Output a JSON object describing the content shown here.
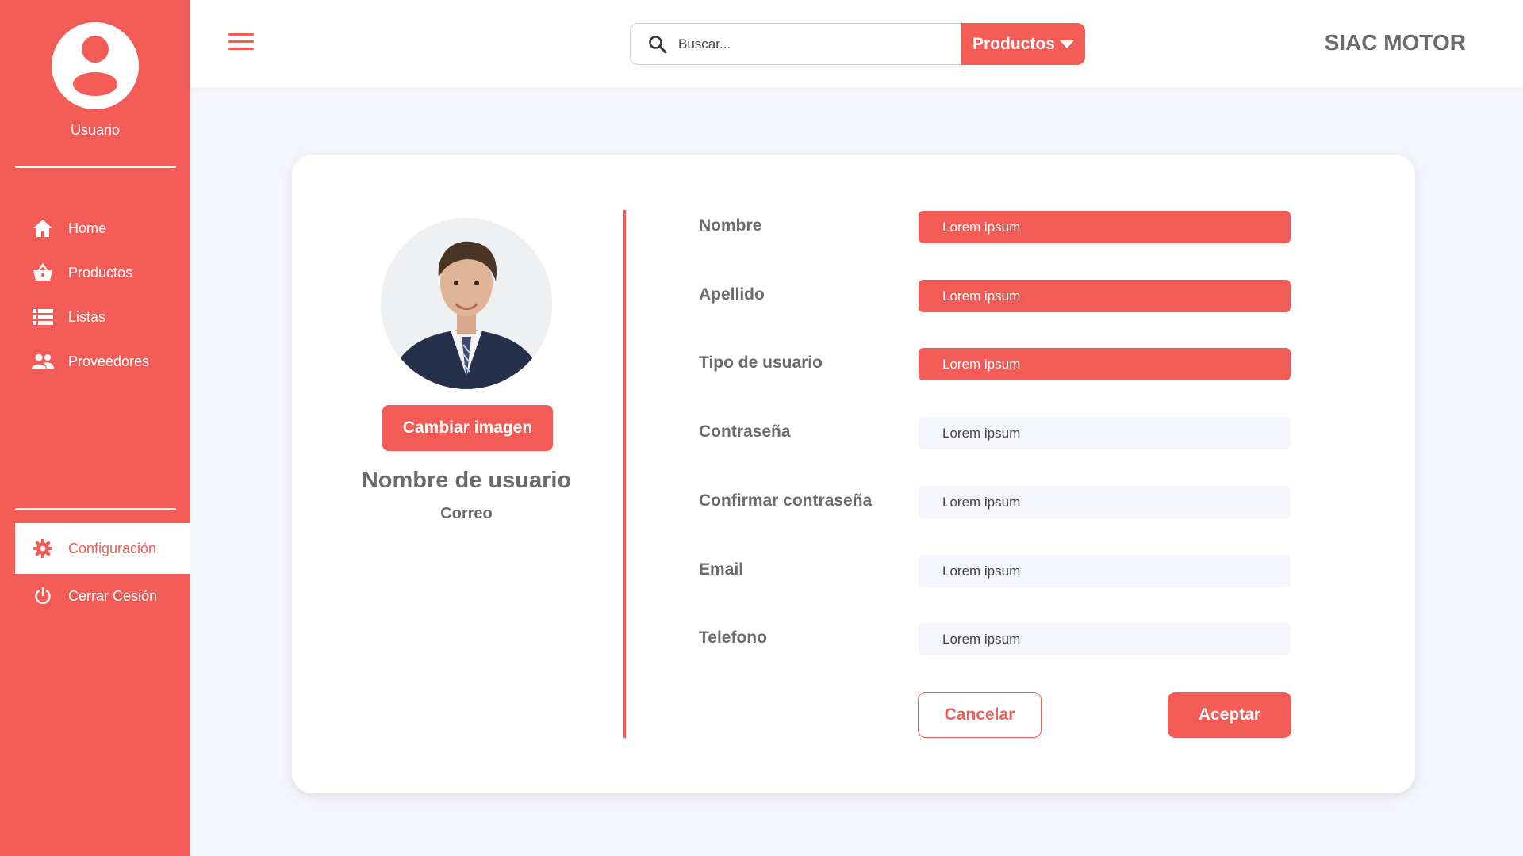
{
  "sidebar": {
    "user_label": "Usuario",
    "items": [
      {
        "label": "Home",
        "icon": "home-icon"
      },
      {
        "label": "Productos",
        "icon": "basket-icon"
      },
      {
        "label": "Listas",
        "icon": "list-icon"
      },
      {
        "label": "Proveedores",
        "icon": "people-icon"
      }
    ],
    "bottom_items": [
      {
        "label": "Configuración",
        "icon": "gear-icon",
        "active": true
      },
      {
        "label": "Cerrar Cesión",
        "icon": "power-icon"
      }
    ]
  },
  "header": {
    "search_placeholder": "Buscar...",
    "category_selected": "Productos",
    "brand": "SIAC MOTOR"
  },
  "profile": {
    "change_image_label": "Cambiar imagen",
    "username": "Nombre de usuario",
    "email": "Correo"
  },
  "form": {
    "fields": [
      {
        "label": "Nombre",
        "value": "Lorem ipsum",
        "style": "filled"
      },
      {
        "label": "Apellido",
        "value": "Lorem ipsum",
        "style": "filled"
      },
      {
        "label": "Tipo de usuario",
        "value": "Lorem ipsum",
        "style": "filled"
      },
      {
        "label": "Contraseña",
        "value": "Lorem ipsum",
        "style": "empty"
      },
      {
        "label": "Confirmar contraseña",
        "value": "Lorem ipsum",
        "style": "empty"
      },
      {
        "label": "Email",
        "value": "Lorem ipsum",
        "style": "empty"
      },
      {
        "label": "Telefono",
        "value": "Lorem ipsum",
        "style": "empty"
      }
    ],
    "cancel_label": "Cancelar",
    "accept_label": "Aceptar"
  },
  "colors": {
    "accent": "#f35b56",
    "background": "#f5f6fb",
    "text_gray": "#6b6b6b"
  }
}
